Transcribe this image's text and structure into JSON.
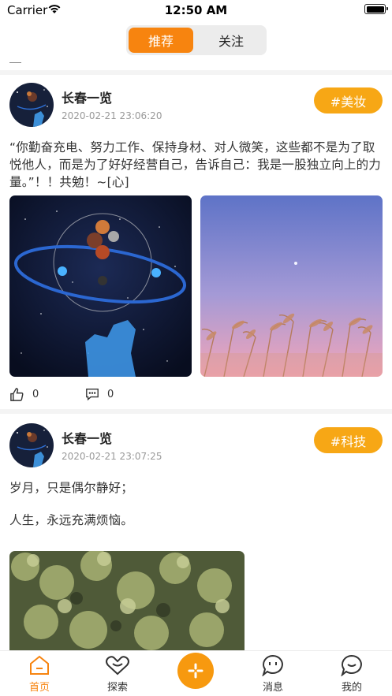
{
  "status": {
    "carrier": "Carrier",
    "time": "12:50 AM"
  },
  "segment": {
    "recommend": "推荐",
    "follow": "关注"
  },
  "posts": [
    {
      "author": "长春一览",
      "time": "2020-02-21 23:06:20",
      "tag": "#美妆",
      "text": "“你勤奋充电、努力工作、保持身材、对人微笑，这些都不是为了取悦他人，而是为了好好经营自己，告诉自己：我是一股独立向上的力量。”！！共勉！~[心]",
      "likes": "0",
      "comments": "0"
    },
    {
      "author": "长春一览",
      "time": "2020-02-21 23:07:25",
      "tag": "#科技",
      "text1": "岁月，只是偶尔静好；",
      "text2": "人生，永远充满烦恼。"
    }
  ],
  "tabbar": {
    "home": "首页",
    "explore": "探索",
    "messages": "消息",
    "mine": "我的"
  },
  "colors": {
    "accent": "#f7840f",
    "tag": "#f7a715"
  },
  "icons": [
    "wifi-icon",
    "battery-icon",
    "thumbs-up-icon",
    "comment-icon",
    "home-icon",
    "heart-icon",
    "plus-icon",
    "chat-icon",
    "location-icon"
  ]
}
